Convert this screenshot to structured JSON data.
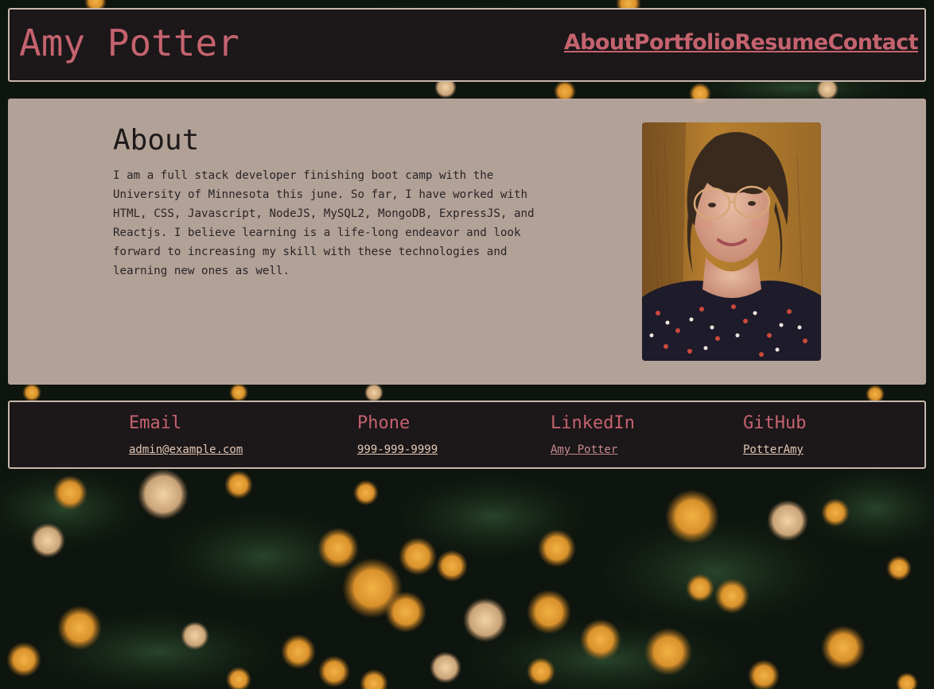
{
  "header": {
    "title": "Amy Potter",
    "nav": [
      "About",
      "Portfolio",
      "Resume",
      "Contact"
    ]
  },
  "about": {
    "heading": "About",
    "body": "I am a full stack developer finishing boot camp with the University of Minnesota this june. So far, I have worked with HTML, CSS, Javascript, NodeJS, MySQL2, MongoDB, ExpressJS, and Reactjs. I believe learning is a life-long endeavor and look forward to increasing my skill with these technologies and learning new ones as well."
  },
  "footer": {
    "contacts": [
      {
        "label": "Email",
        "value": "admin@example.com"
      },
      {
        "label": "Phone",
        "value": "999-999-9999"
      },
      {
        "label": "LinkedIn",
        "value": "Amy Potter"
      },
      {
        "label": "GitHub",
        "value": "PotterAmy"
      }
    ]
  },
  "colors": {
    "accent": "#c4636e",
    "panel_dark": "#1c1719",
    "panel_light": "#c4b0a6",
    "border": "#c8b8ad"
  }
}
